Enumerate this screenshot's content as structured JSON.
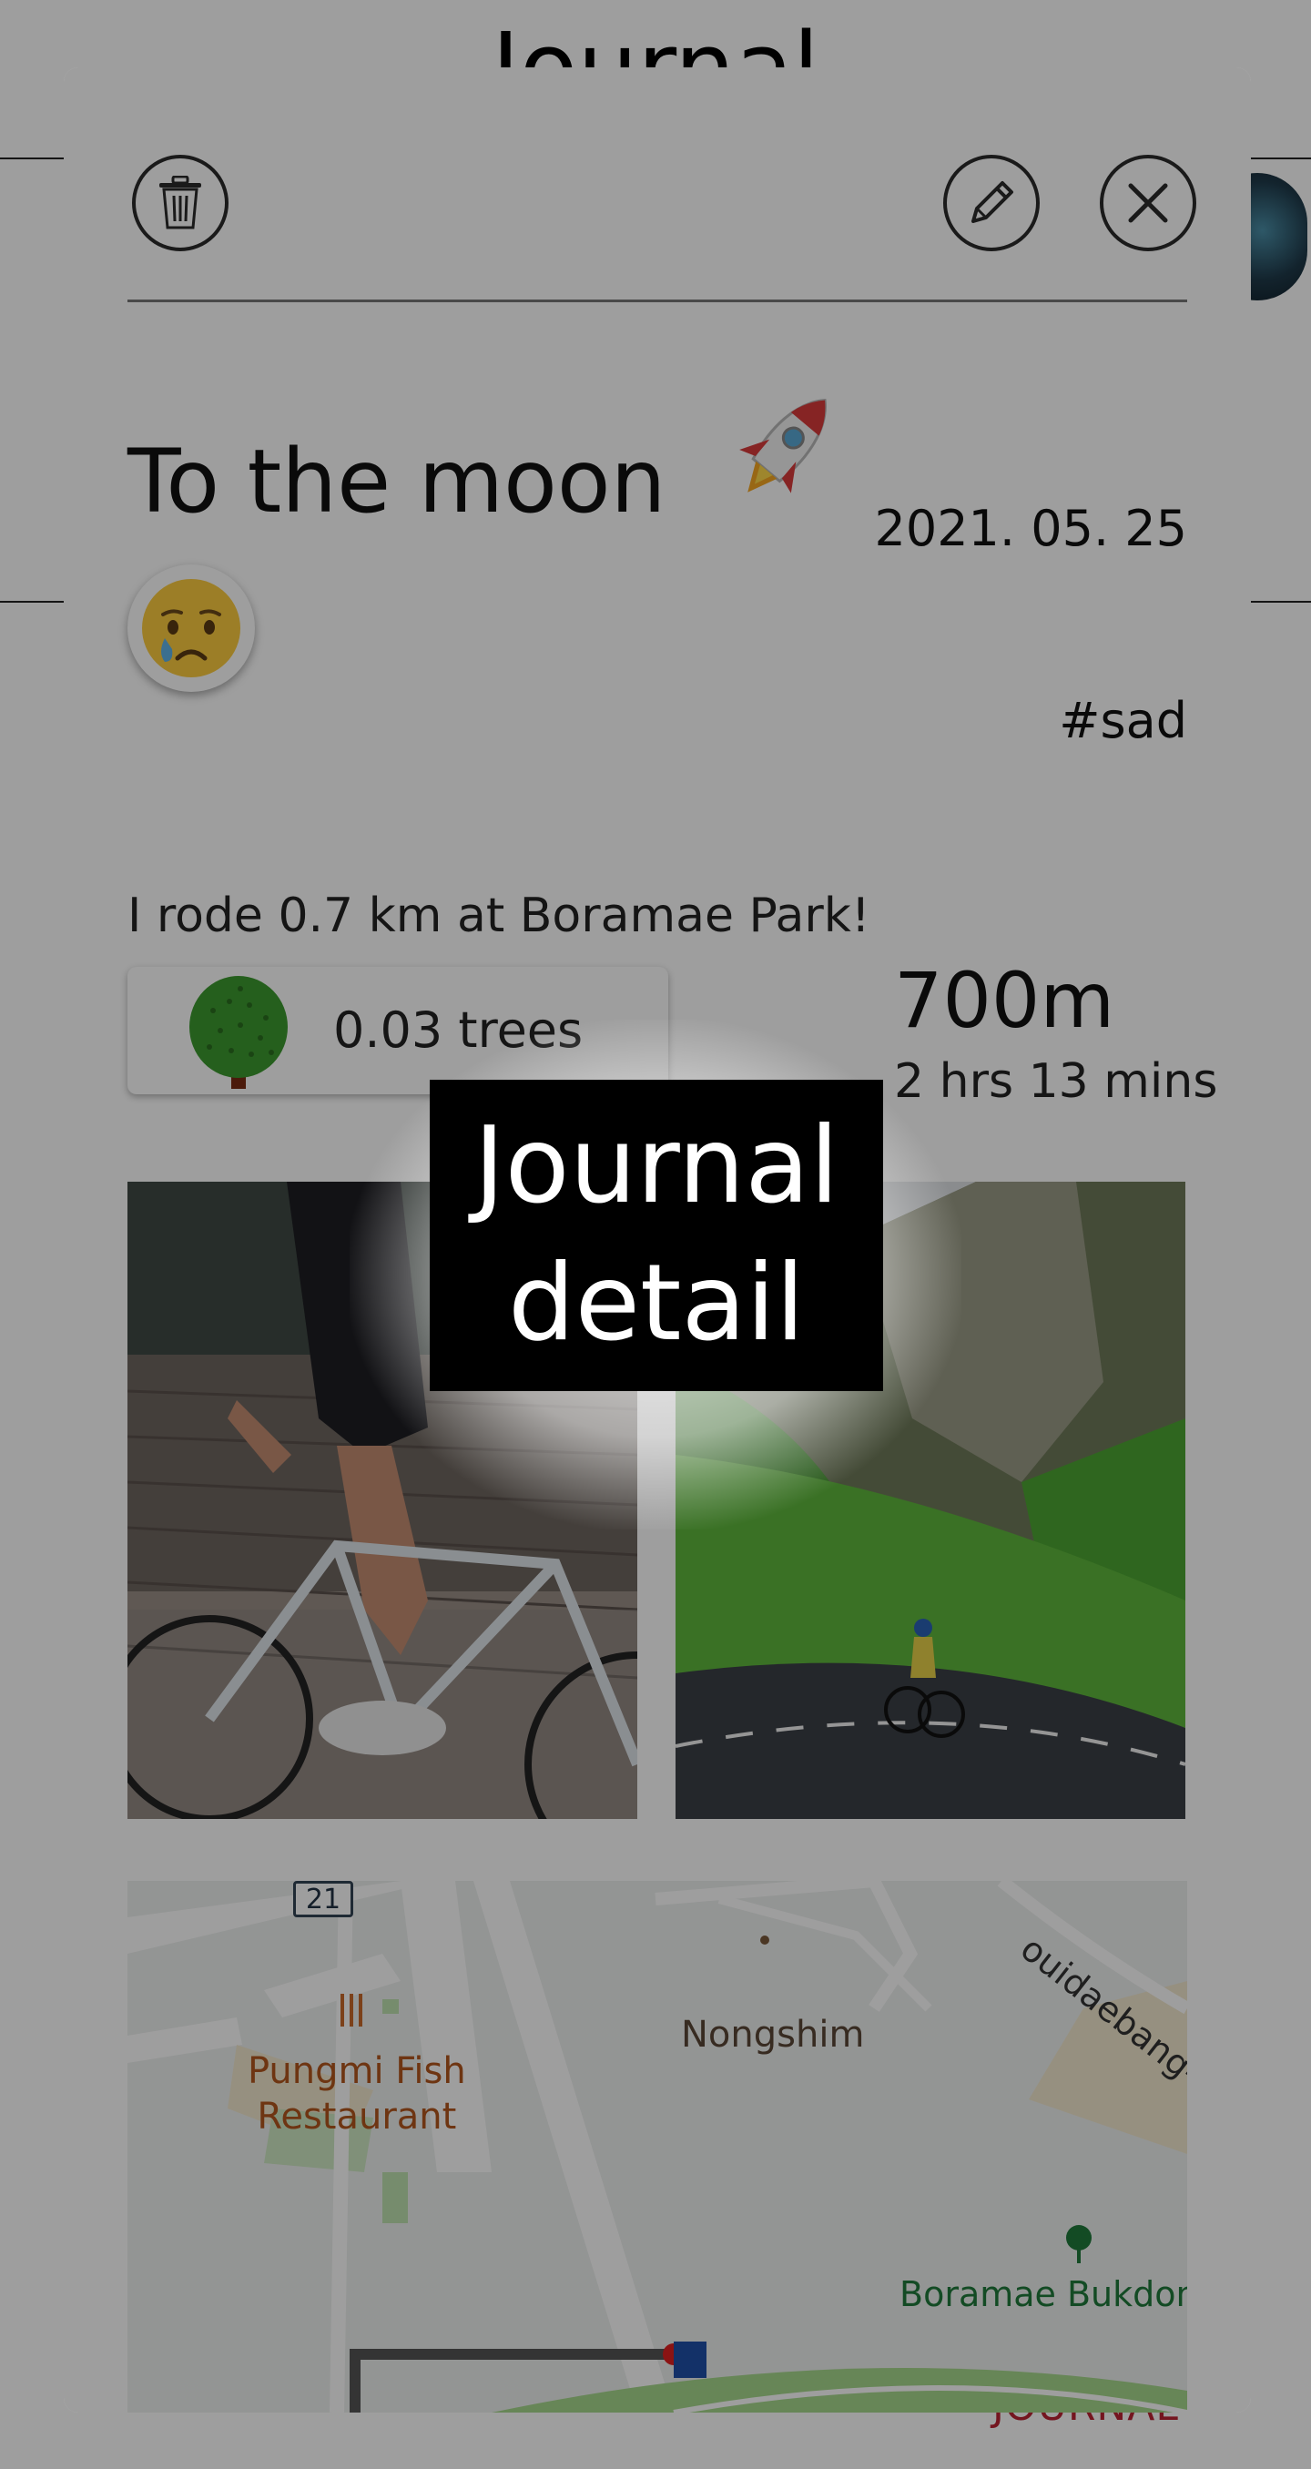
{
  "background_page": {
    "title": "Journal",
    "footer_text": "JOURNAL"
  },
  "journal_detail": {
    "title": "To the moon",
    "title_emoji": "rocket",
    "date": "2021. 05. 25",
    "mood": "crying-face",
    "tag": "#sad",
    "body": "I rode 0.7 km at Boramae Park!",
    "trees": "0.03 trees",
    "distance": "700m",
    "duration": "2 hrs 13 mins",
    "photos": [
      "cyclist-on-cobblestone",
      "cyclist-on-mountain-road"
    ]
  },
  "map": {
    "labels": {
      "nongshim": "Nongshim",
      "pungmi": "Pungmi Fish Restaurant",
      "pungmi_line1": "Pungmi Fish",
      "pungmi_line2": "Restaurant",
      "boramae": "Boramae Bukdong",
      "ouidaebang": "ouidaebang-",
      "road_number": "21"
    }
  },
  "overlay_caption": {
    "line1": "Journal",
    "line2": "detail"
  }
}
